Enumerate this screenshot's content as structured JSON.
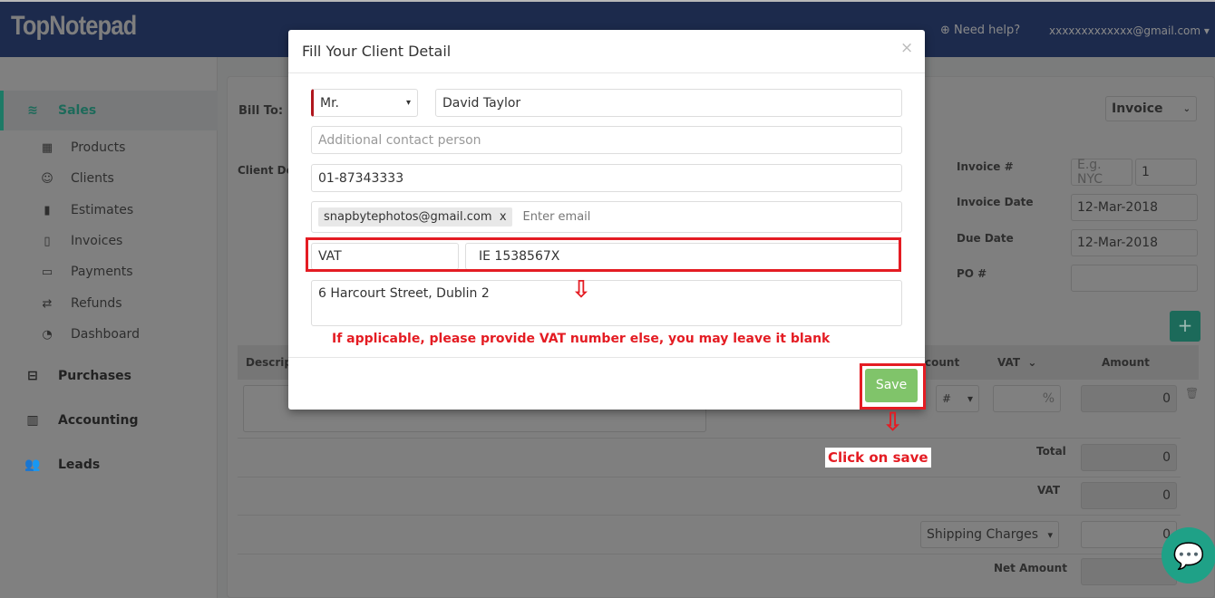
{
  "header": {
    "logo": "TopNotepad",
    "help": "Need help?",
    "user": "xxxxxxxxxxxxx@gmail.com"
  },
  "sidebar": {
    "sales": "Sales",
    "items": [
      {
        "label": "Products",
        "icon": "cubes-icon"
      },
      {
        "label": "Clients",
        "icon": "user-icon"
      },
      {
        "label": "Estimates",
        "icon": "file-icon"
      },
      {
        "label": "Invoices",
        "icon": "file-outline-icon"
      },
      {
        "label": "Payments",
        "icon": "credit-card-icon"
      },
      {
        "label": "Refunds",
        "icon": "exchange-icon"
      },
      {
        "label": "Dashboard",
        "icon": "dashboard-icon"
      }
    ],
    "purchases": "Purchases",
    "accounting": "Accounting",
    "leads": "Leads"
  },
  "form": {
    "bill_to": "Bill To:",
    "client_details": "Client De",
    "doc_type": "Invoice",
    "invoice_no_label": "Invoice #",
    "invoice_prefix_placeholder": "E.g. NYC",
    "invoice_no": "1",
    "invoice_date_label": "Invoice Date",
    "invoice_date": "12-Mar-2018",
    "due_date_label": "Due Date",
    "due_date": "12-Mar-2018",
    "po_label": "PO #",
    "add": "+"
  },
  "table": {
    "headers": {
      "description": "Descrip",
      "discount": "count",
      "vat": "VAT",
      "amount": "Amount"
    },
    "discount_type": "#",
    "vat_placeholder": "%",
    "amount": "0",
    "total_label": "Total",
    "total": "0",
    "vat_label": "VAT",
    "vat_total": "0",
    "shipping": "Shipping Charges",
    "shipping_value": "0",
    "net_label": "Net Amount"
  },
  "modal": {
    "title": "Fill Your Client Detail",
    "close": "×",
    "salutation": "Mr.",
    "name": "David Taylor",
    "contact_placeholder": "Additional contact person",
    "phone": "01-87343333",
    "email_tag": "snapbytephotos@gmail.com",
    "email_tag_remove": "x",
    "email_placeholder": "Enter email",
    "tax_label": "VAT",
    "tax_number": "IE 1538567X",
    "address": "6 Harcourt Street, Dublin 2",
    "save": "Save"
  },
  "annotations": {
    "vat_note": "If applicable, please provide VAT number else, you may leave it blank",
    "save_note": "Click on save"
  },
  "colors": {
    "header": "#1c2a4c",
    "accent": "#1fa187",
    "save": "#80c46a",
    "annotation": "#e41c23"
  }
}
